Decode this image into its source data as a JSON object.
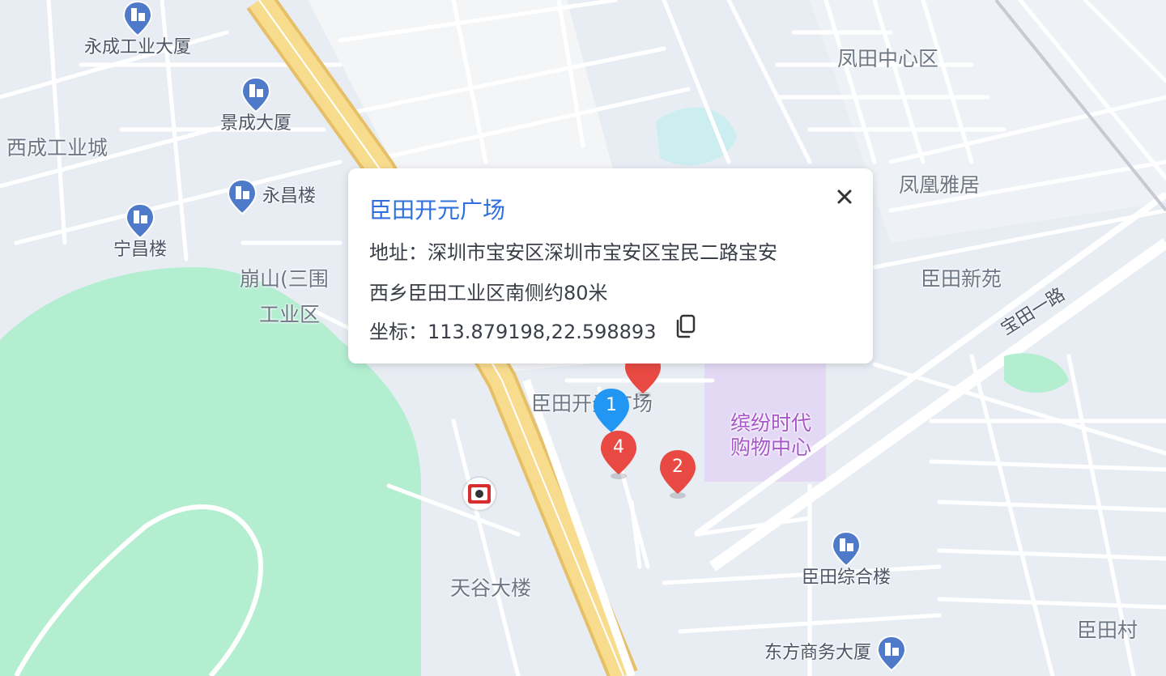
{
  "map": {
    "colors": {
      "background": "#e8edf4",
      "road": "#ffffff",
      "highway": "#f4d47c",
      "park": "#b3eed1",
      "water": "#cdeef0",
      "mall": "#e3d9f5"
    },
    "area_labels": {
      "xicheng": "西成工业城",
      "fengtian_center": "凤田中心区",
      "fenghuang": "凤凰雅居",
      "chentian_xinyuan": "臣田新苑",
      "bengshan_l1": "崩山(三围",
      "bengshan_l2": "工业区",
      "chentian_kaiyuan": "臣田开元广场",
      "tiangu": "天谷大楼",
      "chentian_cun": "臣田村",
      "baotian_road": "宝田一路",
      "binfen_l1": "缤纷时代",
      "binfen_l2": "购物中心"
    },
    "pois": {
      "yongcheng": "永成工业大厦",
      "jingcheng": "景成大厦",
      "yongchang": "永昌楼",
      "ningchang": "宁昌楼",
      "chentian_zonghe": "臣田综合楼",
      "dongfang": "东方商务大厦"
    },
    "markers": [
      {
        "label": "1",
        "color": "#2196f3"
      },
      {
        "label": "4",
        "color": "#e84a43"
      },
      {
        "label": "2",
        "color": "#e84a43"
      },
      {
        "label": "",
        "color": "#e84a43"
      }
    ],
    "icons": {
      "poi": "building-icon",
      "restaurant": "kfc-icon"
    }
  },
  "popup": {
    "title": "臣田开元广场",
    "address_line1": "地址：深圳市宝安区深圳市宝安区宝民二路宝安",
    "address_line2": "西乡臣田工业区南侧约80米",
    "coords": "坐标：113.879198,22.598893",
    "close_icon": "close-icon",
    "copy_icon": "copy-icon"
  }
}
